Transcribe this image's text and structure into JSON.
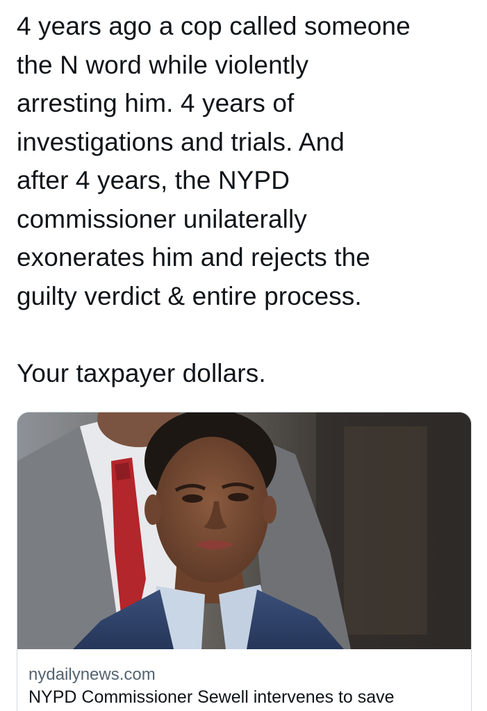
{
  "tweet": {
    "text_lines": [
      "4 years ago a cop called someone",
      "the N word while violently",
      "arresting him. 4 years of",
      "investigations and trials. And",
      "after 4 years, the NYPD",
      "commissioner unilaterally",
      "exonerates him and rejects the",
      "guilty verdict & entire process."
    ],
    "closing_line": "Your taxpayer dollars."
  },
  "link_card": {
    "domain": "nydailynews.com",
    "title": "NYPD Commissioner Sewell intervenes to save"
  }
}
